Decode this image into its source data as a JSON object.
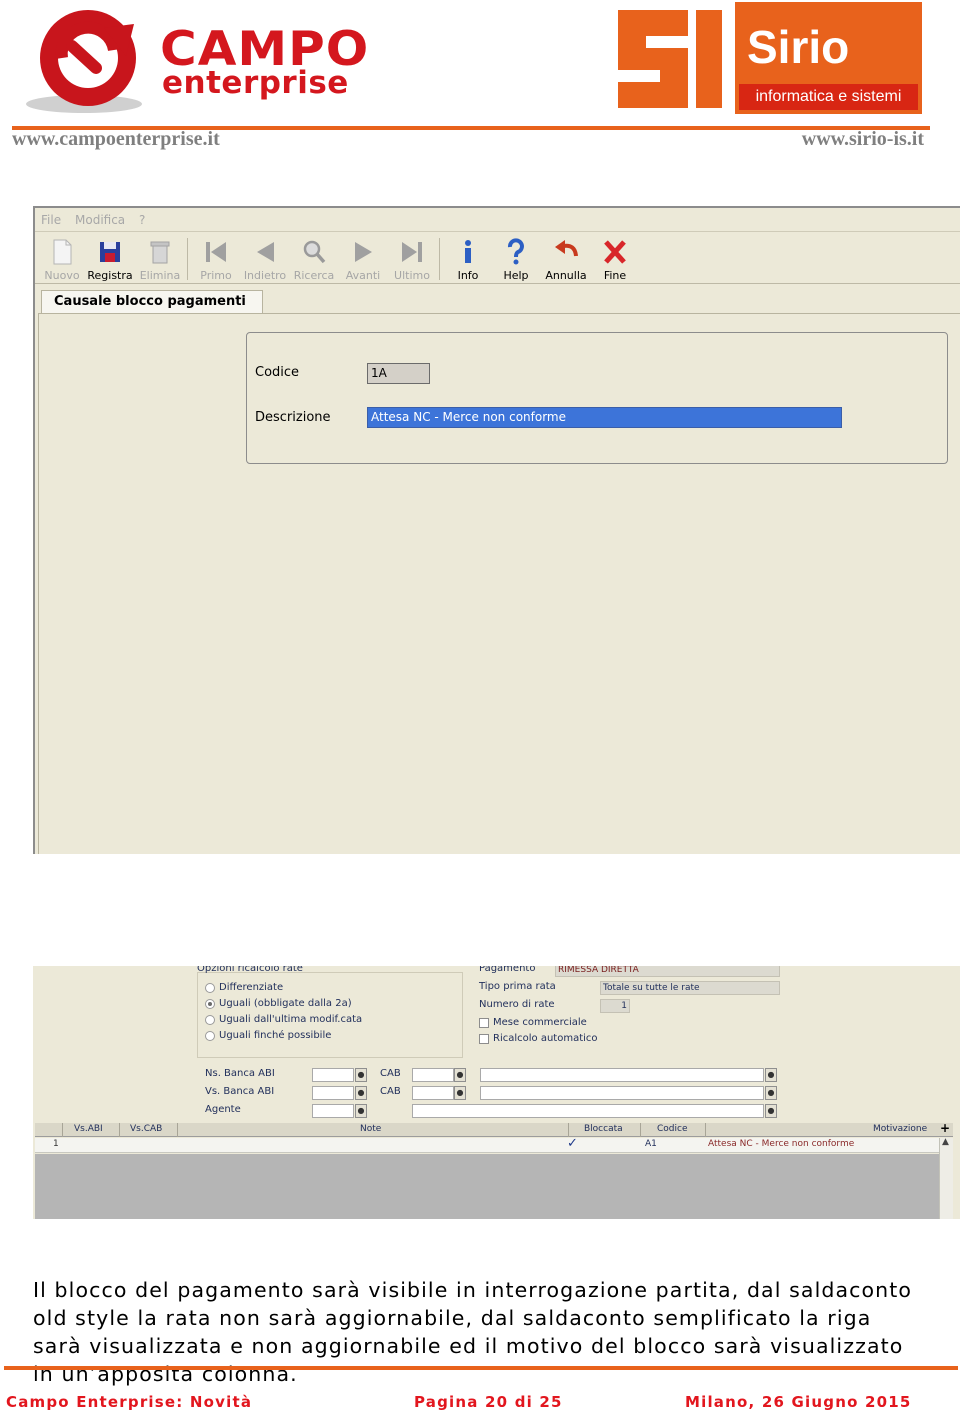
{
  "header": {
    "logo_left": {
      "word1": "CAMPO",
      "word2": "enterprise"
    },
    "logo_right": {
      "name": "Sirio",
      "tagline": "informatica e sistemi"
    },
    "url_left": "www.campoenterprise.it",
    "url_right": "www.sirio-is.it"
  },
  "screenshot1": {
    "menu": [
      "File",
      "Modifica",
      "?"
    ],
    "toolbar": [
      {
        "label": "Nuovo",
        "icon": "new-document-icon",
        "enabled": false
      },
      {
        "label": "Registra",
        "icon": "save-disk-icon",
        "enabled": true
      },
      {
        "label": "Elimina",
        "icon": "delete-trash-icon",
        "enabled": false
      },
      {
        "label": "Primo",
        "icon": "first-record-icon",
        "enabled": false
      },
      {
        "label": "Indietro",
        "icon": "previous-icon",
        "enabled": false
      },
      {
        "label": "Ricerca",
        "icon": "search-magnifier-icon",
        "enabled": false
      },
      {
        "label": "Avanti",
        "icon": "next-icon",
        "enabled": false
      },
      {
        "label": "Ultimo",
        "icon": "last-record-icon",
        "enabled": false
      },
      {
        "label": "Info",
        "icon": "info-icon",
        "enabled": true
      },
      {
        "label": "Help",
        "icon": "help-question-icon",
        "enabled": true
      },
      {
        "label": "Annulla",
        "icon": "undo-arrow-icon",
        "enabled": true
      },
      {
        "label": "Fine",
        "icon": "close-x-icon",
        "enabled": true
      }
    ],
    "tab": "Causale blocco pagamenti",
    "form": {
      "codice_label": "Codice",
      "codice_value": "1A",
      "descrizione_label": "Descrizione",
      "descrizione_value": "Attesa NC - Merce non conforme"
    }
  },
  "screenshot2": {
    "options_title": "Opzioni ricalcolo rate",
    "options": [
      {
        "label": "Differenziate",
        "selected": false
      },
      {
        "label": "Uguali (obbligate dalla 2a)",
        "selected": true
      },
      {
        "label": "Uguali dall'ultima modif.cata",
        "selected": false
      },
      {
        "label": "Uguali finché possibile",
        "selected": false
      }
    ],
    "pagamento_label": "Pagamento",
    "pagamento_value": "RIMESSA DIRETTA",
    "tipo_prima_rata_label": "Tipo prima rata",
    "tipo_prima_rata_value": "Totale su tutte le rate",
    "numero_rate_label": "Numero di rate",
    "numero_rate_value": "1",
    "mese_commerciale_label": "Mese commerciale",
    "mese_commerciale_checked": false,
    "ricalcolo_label": "Ricalcolo automatico",
    "ricalcolo_checked": false,
    "banca_ns_label": "Ns. Banca ABI",
    "banca_vs_label": "Vs. Banca ABI",
    "cab_label": "CAB",
    "agente_label": "Agente",
    "grid": {
      "columns": [
        "Vs.ABI",
        "Vs.CAB",
        "Note",
        "Bloccata",
        "Codice",
        "Motivazione"
      ],
      "rows": [
        {
          "n": "1",
          "vs_abi": "",
          "vs_cab": "",
          "note": "",
          "bloccata": "✓",
          "codice": "A1",
          "motivazione": "Attesa NC - Merce non conforme"
        }
      ]
    }
  },
  "body_text": "Il blocco del pagamento sarà visibile in interrogazione partita,  dal saldaconto old style la rata non sarà aggiornabile, dal saldaconto semplificato la riga sarà visualizzata e non aggiornabile ed il motivo del blocco sarà visualizzato in un’apposita colonna.",
  "footer": {
    "left": "Campo Enterprise: Novità",
    "center": "Pagina 20 di 25",
    "right": "Milano, 26 Giugno 2015"
  },
  "colors": {
    "accent_orange": "#e8621c",
    "campo_red": "#d4171e",
    "footer_red": "#e2161e",
    "selection_blue": "#3d74d9"
  }
}
